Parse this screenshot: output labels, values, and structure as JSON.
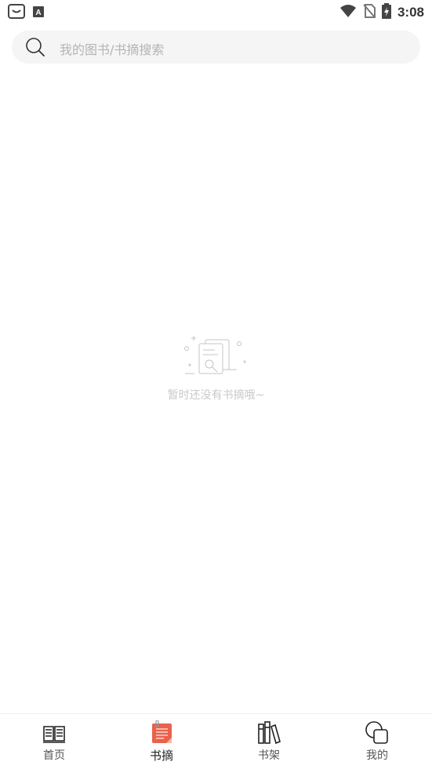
{
  "status_bar": {
    "time": "3:08",
    "left_icons": [
      "shopping-bag-icon",
      "font-a-icon"
    ],
    "right_icons": [
      "wifi-icon",
      "no-sim-icon",
      "battery-charging-icon"
    ]
  },
  "search": {
    "placeholder": "我的图书/书摘搜索",
    "icon": "search-icon"
  },
  "empty_state": {
    "icon": "document-search-icon",
    "message": "暂时还没有书摘哦~"
  },
  "bottom_nav": {
    "items": [
      {
        "label": "首页",
        "icon": "open-book-icon",
        "active": false
      },
      {
        "label": "书摘",
        "icon": "note-icon",
        "active": true
      },
      {
        "label": "书架",
        "icon": "bookshelf-icon",
        "active": false
      },
      {
        "label": "我的",
        "icon": "profile-shapes-icon",
        "active": false
      }
    ]
  },
  "colors": {
    "accent": "#e8624c",
    "text_primary": "#222222",
    "text_muted": "#c9c9c9",
    "search_bg": "#f5f5f5"
  }
}
